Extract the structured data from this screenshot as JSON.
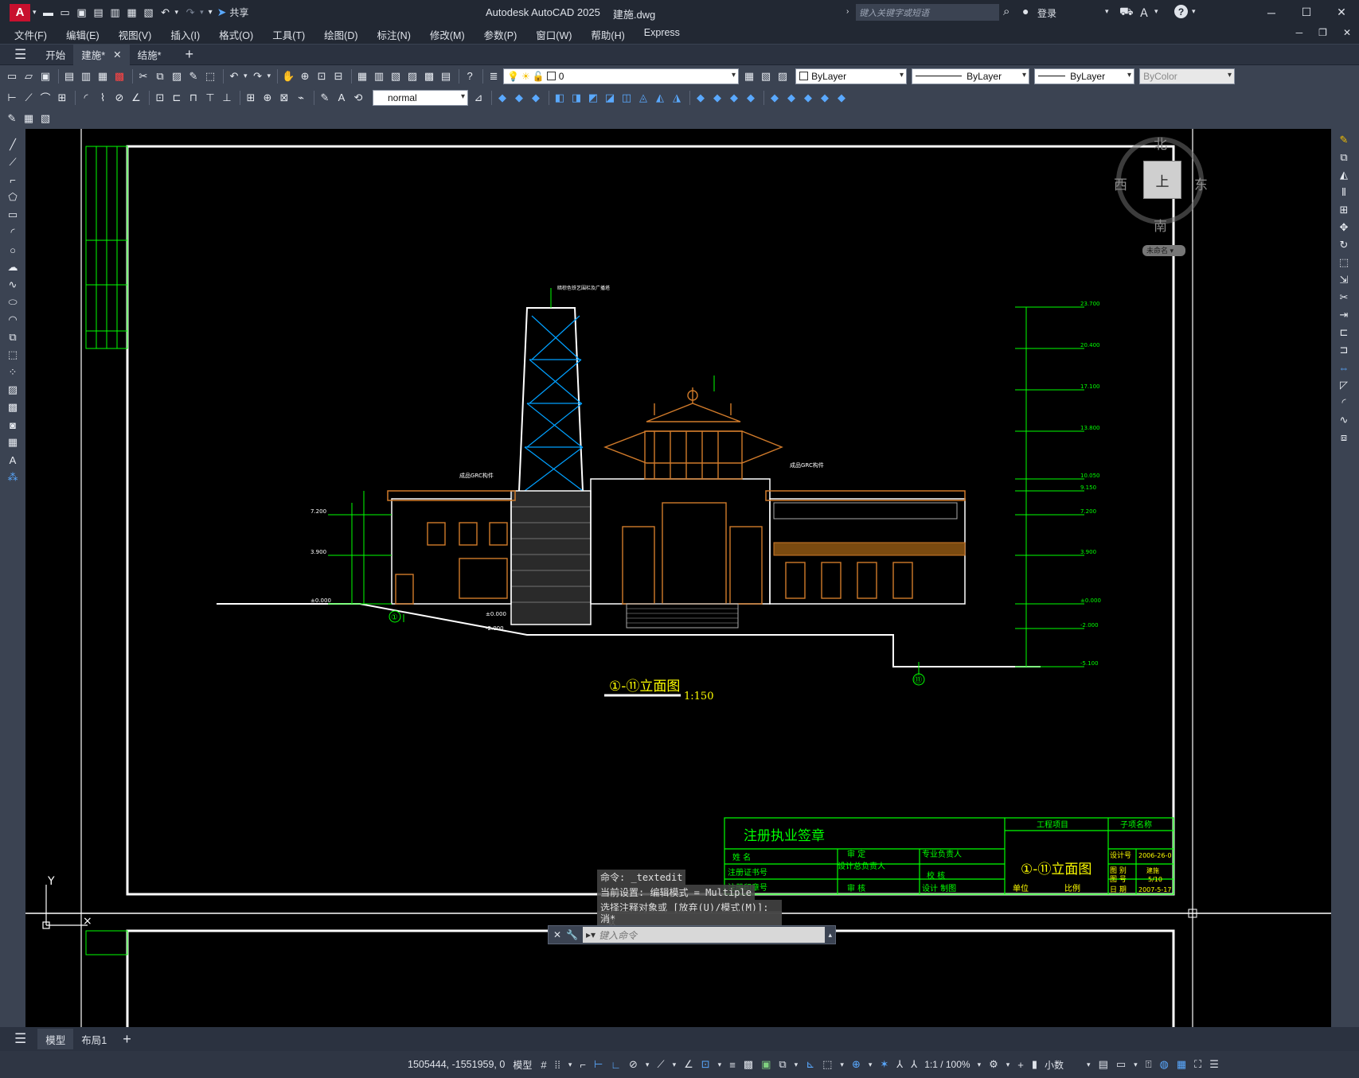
{
  "titlebar": {
    "app_title": "Autodesk AutoCAD 2025",
    "file_name": "建施.dwg",
    "share_label": "共享",
    "search_placeholder": "键入关键字或短语",
    "signin_label": "登录"
  },
  "menu": [
    "文件(F)",
    "编辑(E)",
    "视图(V)",
    "插入(I)",
    "格式(O)",
    "工具(T)",
    "绘图(D)",
    "标注(N)",
    "修改(M)",
    "参数(P)",
    "窗口(W)",
    "帮助(H)",
    "Express"
  ],
  "doc_tabs": [
    {
      "label": "开始",
      "active": false
    },
    {
      "label": "建施*",
      "active": true
    },
    {
      "label": "结施*",
      "active": false
    }
  ],
  "toolbar": {
    "layer_value": "0",
    "color_value": "ByLayer",
    "linetype_value": "ByLayer",
    "lineweight_value": "ByLayer",
    "plotstyle_value": "ByColor",
    "dimstyle_value": "normal"
  },
  "viewcube": {
    "north": "北",
    "south": "南",
    "east": "东",
    "west": "西",
    "top": "上",
    "wcs": "未命名"
  },
  "drawing": {
    "title": "①-⑪立面图",
    "scale": "1:150",
    "grid_left": "①",
    "grid_right": "⑪",
    "levels_right": [
      "23.700",
      "20.400",
      "17.100",
      "13.800",
      "10.050",
      "9.150",
      "7.200",
      "3.900",
      "±0.000",
      "-2.000",
      "-5.100"
    ],
    "levels_left": [
      "7.200",
      "3.900",
      "±0.000"
    ],
    "label_top_tower": "暗棕色铁艺围栏及广播塔",
    "label_grc": "成品GRC构件",
    "label_ground1": "±0.000",
    "label_ground2": "-2.000"
  },
  "titleblock": {
    "stamp_title": "注册执业签章",
    "rows": [
      "姓 名",
      "注册证书号",
      "注册印章号"
    ],
    "col2": [
      "审 定",
      "设计总负责人",
      "审 核"
    ],
    "col3": [
      "专业负责人",
      "校 核",
      "设计 制图"
    ],
    "project_label": "工程项目",
    "subitem_label": "子项名称",
    "drawing_name": "①-⑪立面图",
    "unit_label": "单位",
    "scale_label": "比例",
    "info": [
      {
        "k": "设计号",
        "v": "2006-26-0"
      },
      {
        "k": "图 别",
        "v": "建施"
      },
      {
        "k": "图 号",
        "v": "5/10"
      },
      {
        "k": "日 期",
        "v": "2007-5-17"
      }
    ]
  },
  "command": {
    "line1": "命令: _textedit",
    "line2": "当前设置: 编辑模式 = Multiple",
    "line3": "选择注释对象或 [放弃(U)/模式(M)]: *取",
    "line4": "消*",
    "input_placeholder": "键入命令"
  },
  "layout_tabs": [
    {
      "label": "模型",
      "active": true
    },
    {
      "label": "布局1",
      "active": false
    }
  ],
  "status": {
    "coords": "1505444, -1551959, 0",
    "model_label": "模型",
    "scale_label": "1:1 / 100%",
    "units_label": "小数"
  },
  "colors": {
    "green": "#00ff00",
    "cyan": "#00a0ff",
    "orange": "#d07a2a",
    "yellow": "#ffff00",
    "white": "#ffffff"
  }
}
